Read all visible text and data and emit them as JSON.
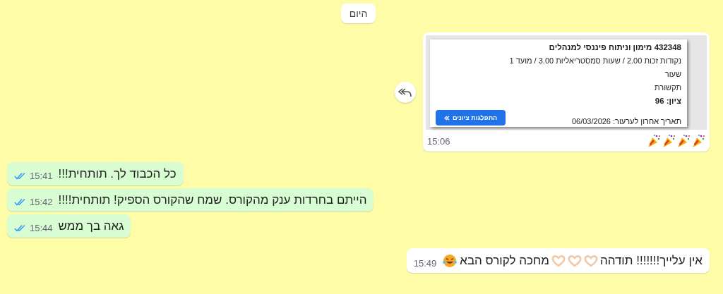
{
  "date_chip": "היום",
  "card_message": {
    "card": {
      "title": "432348 מימון וניתוח פיננסי למנהלים",
      "lines": [
        "נקודות זכות 2.00 / שעות סמסטריאליות 3.00 / מועד 1",
        "שעור",
        "תקשורת"
      ],
      "grade_label": "ציון:",
      "grade": "96",
      "deadline": "תאריך אחרון לערעור: 06/03/2026",
      "button": "התפלגות ציונים"
    },
    "emojis": [
      {
        "kind": "party"
      },
      {
        "kind": "party"
      },
      {
        "kind": "party"
      },
      {
        "kind": "party"
      }
    ],
    "time": "15:06"
  },
  "messages": [
    {
      "kind": "outgoing",
      "read": true,
      "time": "15:41",
      "parts": [
        {
          "kind": "text",
          "text": "כל הכבוד לך. תותחית!!!"
        }
      ]
    },
    {
      "kind": "outgoing",
      "read": true,
      "time": "15:42",
      "parts": [
        {
          "kind": "text",
          "text": "הייתם בחרדות ענק מהקורס. שמח שהקורס הספיק! תותחית!!!!"
        }
      ]
    },
    {
      "kind": "outgoing",
      "read": true,
      "time": "15:44",
      "parts": [
        {
          "kind": "text",
          "text": "גאה בך ממש"
        }
      ]
    },
    {
      "kind": "incoming",
      "time": "15:49",
      "parts": [
        {
          "kind": "text",
          "text": "אין עלייך!!!!!!! תודהה"
        },
        {
          "kind": "heart"
        },
        {
          "kind": "heart"
        },
        {
          "kind": "heart"
        },
        {
          "kind": "text",
          "text": "מחכה לקורס הבא"
        },
        {
          "kind": "laugh"
        }
      ]
    }
  ]
}
